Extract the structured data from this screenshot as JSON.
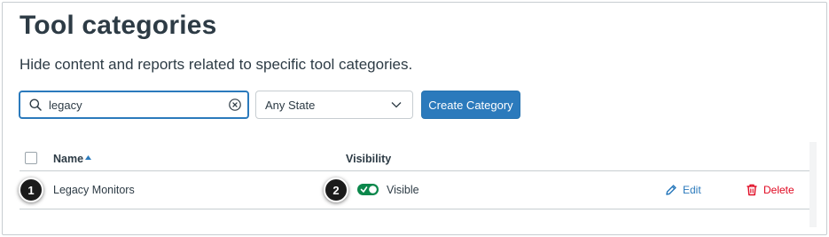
{
  "header": {
    "title": "Tool categories",
    "subtitle": "Hide content and reports related to specific tool categories."
  },
  "toolbar": {
    "search_value": "legacy",
    "state_filter": "Any State",
    "create_label": "Create Category"
  },
  "table": {
    "columns": {
      "name": "Name",
      "visibility": "Visibility"
    },
    "rows": [
      {
        "name": "Legacy Monitors",
        "visibility": "Visible",
        "edit_label": "Edit",
        "delete_label": "Delete"
      }
    ]
  },
  "callouts": [
    "1",
    "2"
  ],
  "colors": {
    "accent": "#2b7abc",
    "danger": "#e0061f",
    "success": "#0b874b",
    "text": "#2d3b45"
  },
  "icons": [
    "search-icon",
    "clear-icon",
    "chevron-down-icon",
    "sort-ascending-icon",
    "toggle-on-icon",
    "pencil-icon",
    "trash-icon"
  ]
}
